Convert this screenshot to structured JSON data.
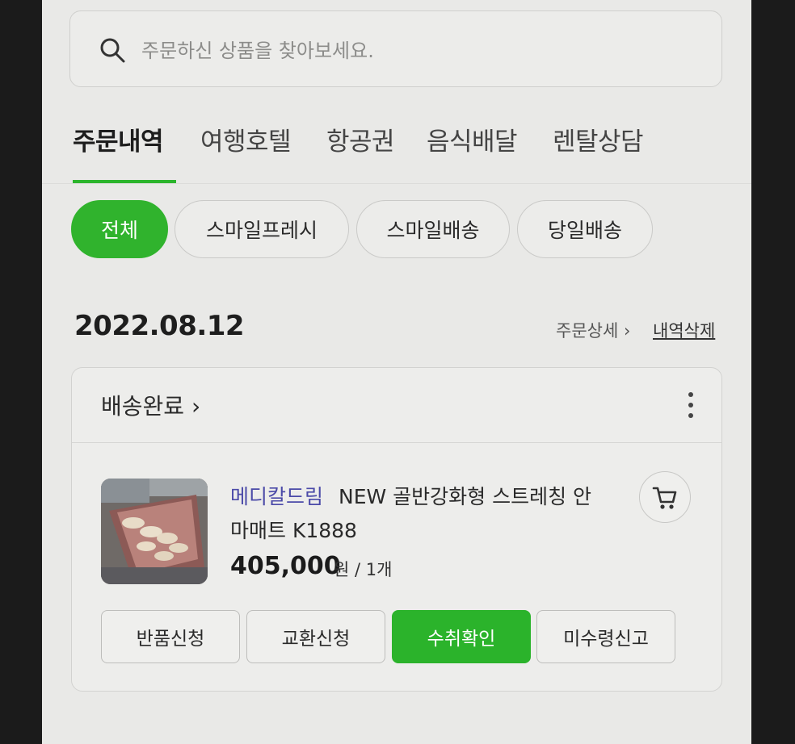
{
  "search": {
    "placeholder": "주문하신 상품을 찾아보세요.",
    "icon": "search-icon"
  },
  "tabs": [
    {
      "label": "주문내역",
      "active": true
    },
    {
      "label": "여행호텔",
      "active": false
    },
    {
      "label": "항공권",
      "active": false
    },
    {
      "label": "음식배달",
      "active": false
    },
    {
      "label": "렌탈상담",
      "active": false
    }
  ],
  "filters": [
    {
      "label": "전체",
      "active": true
    },
    {
      "label": "스마일프레시",
      "active": false
    },
    {
      "label": "스마일배송",
      "active": false
    },
    {
      "label": "당일배송",
      "active": false
    }
  ],
  "order": {
    "date": "2022.08.12",
    "detail_link": "주문상세 ›",
    "delete_link": "내역삭제",
    "status": "배송완료 ›",
    "product": {
      "brand": "메디칼드림",
      "name_line1": "NEW 골반강화형 스트레칭 안",
      "name_line2": "마매트 K1888",
      "price": "405,000",
      "unit": "원 / 1개"
    },
    "actions": [
      {
        "label": "반품신청",
        "primary": false
      },
      {
        "label": "교환신청",
        "primary": false
      },
      {
        "label": "수취확인",
        "primary": true
      },
      {
        "label": "미수령신고",
        "primary": false
      }
    ]
  },
  "colors": {
    "accent": "#2bb32b",
    "background": "#e9e9e7",
    "brand_text": "#4b4aa8"
  }
}
